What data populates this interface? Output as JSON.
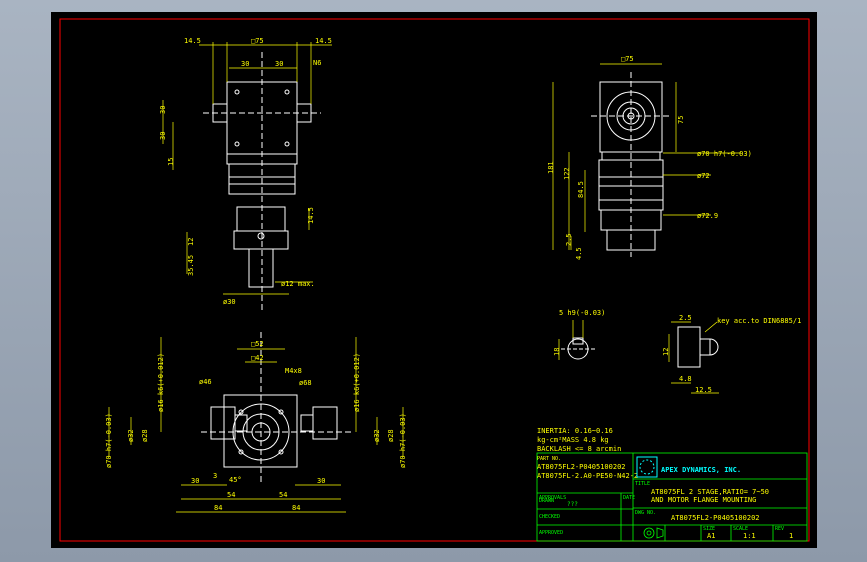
{
  "colors": {
    "background": "#000000",
    "border": "#ff0000",
    "geometry": "#ffffff",
    "dimension": "#ffff00",
    "text": "#ffff00",
    "title_block": "#00ff00",
    "logo": "#00ffff"
  },
  "top_view": {
    "dim_14_5_left": "14.5",
    "dim_square_75": "□75",
    "dim_14_5_right": "14.5",
    "dim_30_a": "30",
    "dim_30_b": "30",
    "thread_n6": "N6",
    "dim_30_side_a": "30",
    "dim_30_side_b": "30",
    "dim_15": "15",
    "dim_14_5_side": "14.5",
    "dim_phi30": "ø30",
    "dim_phi12": "ø12 max.",
    "dim_35_45": "35.45",
    "dim_12_side": "12"
  },
  "side_view": {
    "dim_square_75": "□75",
    "dim_75": "75",
    "dim_181": "181",
    "dim_122": "122",
    "dim_84_5": "84.5",
    "dim_2_5": "2.5",
    "dim_4_5": "4.5",
    "dim_phi70": "ø70 h7(-0.03)",
    "dim_phi72": "ø72",
    "dim_phi72_9": "ø72.9"
  },
  "key_detail": {
    "dim_5h9": "5 h9(-0.03)",
    "dim_18": "18"
  },
  "key_profile": {
    "dim_2_5": "2.5",
    "dim_12": "12",
    "dim_4_8": "4.8",
    "dim_12_5": "12.5",
    "note": "key acc.to DIN6885/1"
  },
  "front_view": {
    "dim_square_52": "□52",
    "dim_square_42": "□42",
    "hole_m4": "M4x8",
    "dim_phi46": "ø46",
    "dim_phi68": "ø68",
    "dim_phi16_left": "ø16 k6(+0.012)",
    "dim_phi16_right": "ø16 k6(+0.012)",
    "dim_phi70_left": "ø70 h7(-0.03)",
    "dim_phi70_right": "ø70 h7(-0.03)",
    "dim_phi32_left": "ø32",
    "dim_phi32_right": "ø32",
    "dim_phi28_left": "ø28",
    "dim_phi28_right": "ø28",
    "dim_3": "3",
    "dim_45deg": "45°",
    "dim_30_left": "30",
    "dim_30_right": "30",
    "dim_54_left": "54",
    "dim_54_right": "54",
    "dim_84_left": "84",
    "dim_84_right": "84"
  },
  "specs": {
    "inertia": "INERTIA: 0.16~0.16",
    "unit_mass": "kg-cm²MASS  4.8 kg",
    "backlash": "BACKLASH <= 8 arcmin",
    "part_label": "PART NO.",
    "part_no": "AT8075FL2-P0405100202",
    "model": "AT8075FL-2.A0-PE50-N42-2"
  },
  "title_block": {
    "approvals": "APPROVALS",
    "date": "DATE",
    "drawn": "DRAWN",
    "drawn_value": "???",
    "checked": "CHECKED",
    "approved": "APPROVED",
    "title_label": "TITLE",
    "company": "APEX DYNAMICS, INC.",
    "title_line1": "AT8075FL 2 STAGE,RATIO= 7~50",
    "title_line2": "AND MOTOR FLANGE MOUNTING",
    "dwg_label": "DWG NO.",
    "dwg_no": "AT8075FL2-P0405100202",
    "size_label": "SIZE",
    "size": "A1",
    "scale_label": "SCALE",
    "scale": "1:1",
    "rev_label": "REV",
    "rev": "1"
  }
}
